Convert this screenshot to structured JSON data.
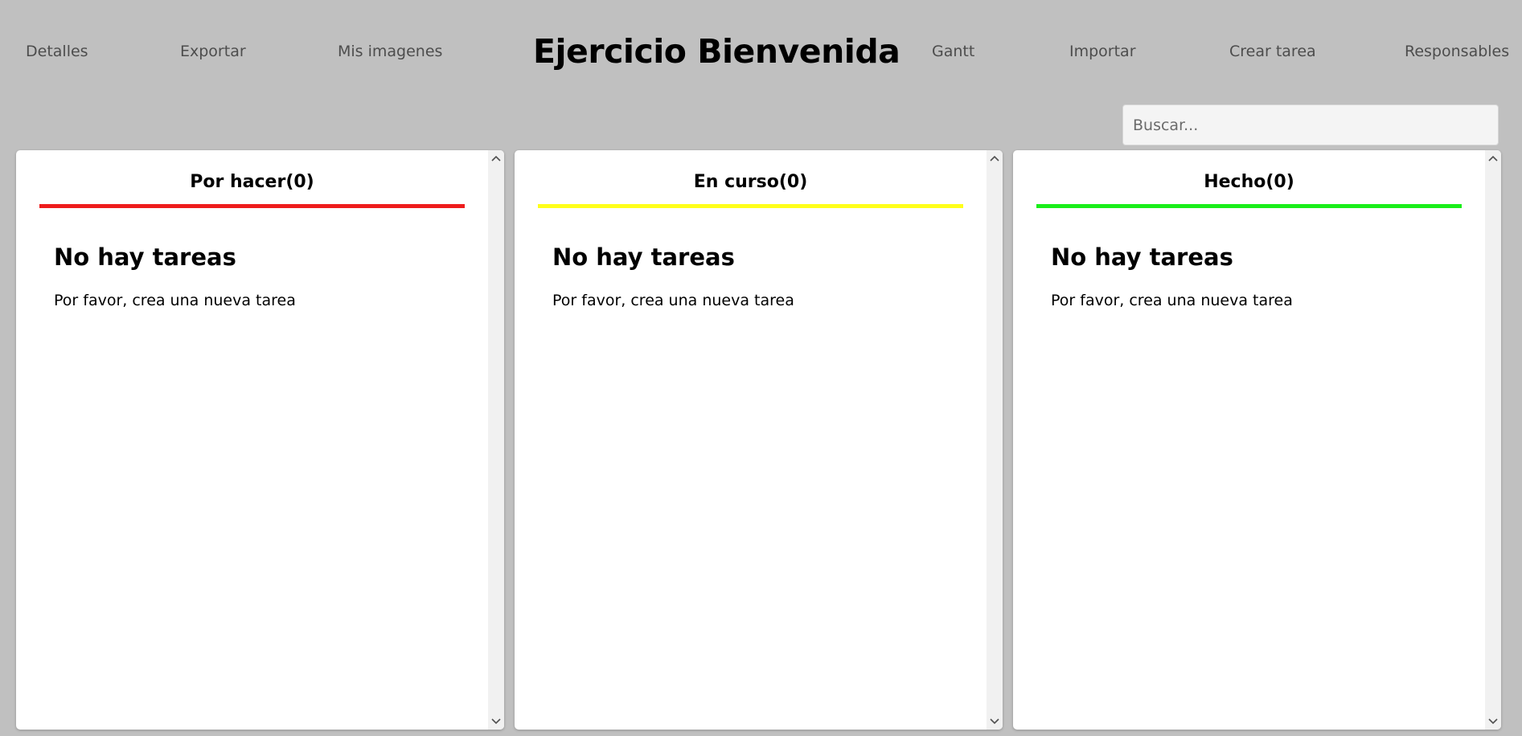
{
  "nav": {
    "left": [
      "Detalles",
      "Exportar",
      "Mis imagenes"
    ],
    "title": "Ejercicio Bienvenida",
    "right": [
      "Gantt",
      "Importar",
      "Crear tarea",
      "Responsables"
    ]
  },
  "search": {
    "placeholder": "Buscar...",
    "value": ""
  },
  "columns": [
    {
      "header": "Por hacer(0)",
      "color": "#ee1c1c",
      "empty_title": "No hay tareas",
      "empty_text": "Por favor, crea una nueva tarea"
    },
    {
      "header": "En curso(0)",
      "color": "#ffff1a",
      "empty_title": "No hay tareas",
      "empty_text": "Por favor, crea una nueva tarea"
    },
    {
      "header": "Hecho(0)",
      "color": "#1aee1a",
      "empty_title": "No hay tareas",
      "empty_text": "Por favor, crea una nueva tarea"
    }
  ],
  "icons": {
    "scroll_up": "chevron-up-icon",
    "scroll_down": "chevron-down-icon"
  }
}
